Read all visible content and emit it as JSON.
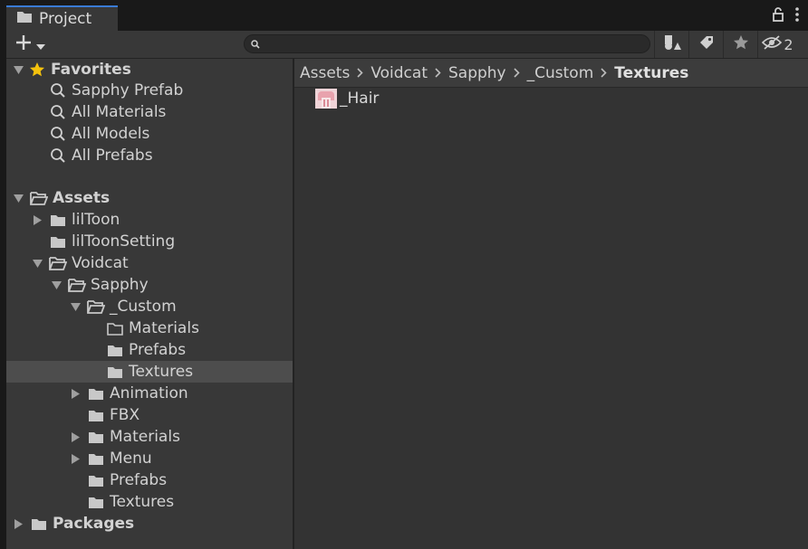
{
  "window": {
    "tab_label": "Project",
    "tab_icon": "folder-icon",
    "actions": [
      "lock-icon",
      "kebab-menu-icon"
    ]
  },
  "toolbar": {
    "create_button": "plus-dropdown",
    "search": {
      "value": "",
      "placeholder": ""
    },
    "buttons": [
      "search-by-type-icon",
      "search-by-label-icon",
      "favorite-star-icon",
      "hidden-packages-icon"
    ],
    "hidden_packages_count": "2"
  },
  "tree": {
    "favorites": {
      "label": "Favorites",
      "items": [
        "Sapphy Prefab",
        "All Materials",
        "All Models",
        "All Prefabs"
      ]
    },
    "assets_label": "Assets",
    "folders": {
      "liltoon": "lilToon",
      "liltoon_setting": "lilToonSetting",
      "voidcat": "Voidcat",
      "sapphy": "Sapphy",
      "custom": "_Custom",
      "custom_materials": "Materials",
      "custom_prefabs": "Prefabs",
      "custom_textures": "Textures",
      "animation": "Animation",
      "fbx": "FBX",
      "materials": "Materials",
      "menu": "Menu",
      "prefabs": "Prefabs",
      "textures": "Textures"
    },
    "packages_label": "Packages",
    "selected": "Textures"
  },
  "breadcrumb": [
    "Assets",
    "Voidcat",
    "Sapphy",
    "_Custom",
    "Textures"
  ],
  "content": {
    "assets": [
      {
        "name": "_Hair",
        "icon": "texture-thumbnail"
      }
    ]
  },
  "colors": {
    "accent": "#3a7bd5",
    "panel": "#383838",
    "content": "#333333",
    "favorite_star": "#f4c20d",
    "selected_row": "#4d4d4d"
  }
}
